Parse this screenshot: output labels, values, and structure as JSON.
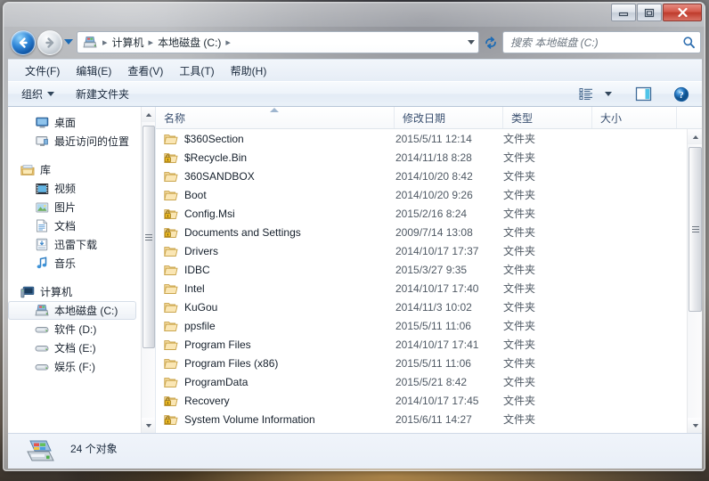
{
  "window": {
    "minimize_label": "最小化",
    "maximize_label": "最大化",
    "close_label": "关闭"
  },
  "nav": {
    "back_label": "后退",
    "forward_label": "前进",
    "history_label": "历史记录",
    "refresh_label": "刷新",
    "breadcrumbs": [
      "计算机",
      "本地磁盘 (C:)"
    ],
    "separator": "▸"
  },
  "search": {
    "placeholder": "搜索 本地磁盘 (C:)",
    "value": ""
  },
  "menubar": {
    "items": [
      {
        "label": "文件(F)"
      },
      {
        "label": "编辑(E)"
      },
      {
        "label": "查看(V)"
      },
      {
        "label": "工具(T)"
      },
      {
        "label": "帮助(H)"
      }
    ]
  },
  "toolbar": {
    "organize_label": "组织",
    "new_folder_label": "新建文件夹",
    "view_label": "更改视图",
    "preview_label": "显示预览窗格",
    "help_label": "帮助"
  },
  "sidebar": {
    "items": [
      {
        "label": "桌面",
        "icon": "desktop-icon",
        "level": "child"
      },
      {
        "label": "最近访问的位置",
        "icon": "recent-icon",
        "level": "child"
      },
      {
        "label": "库",
        "icon": "library-icon",
        "level": "group"
      },
      {
        "label": "视频",
        "icon": "video-icon",
        "level": "child"
      },
      {
        "label": "图片",
        "icon": "picture-icon",
        "level": "child"
      },
      {
        "label": "文档",
        "icon": "document-icon",
        "level": "child"
      },
      {
        "label": "迅雷下载",
        "icon": "download-icon",
        "level": "child"
      },
      {
        "label": "音乐",
        "icon": "music-icon",
        "level": "child"
      },
      {
        "label": "计算机",
        "icon": "computer-icon",
        "level": "group"
      },
      {
        "label": "本地磁盘 (C:)",
        "icon": "harddisk-icon",
        "level": "child",
        "selected": true
      },
      {
        "label": "软件 (D:)",
        "icon": "drive-icon",
        "level": "child"
      },
      {
        "label": "文档 (E:)",
        "icon": "drive-icon",
        "level": "child"
      },
      {
        "label": "娱乐 (F:)",
        "icon": "drive-icon",
        "level": "child"
      }
    ]
  },
  "filelist": {
    "columns": [
      {
        "label": "名称",
        "key": "name",
        "sorted": "asc"
      },
      {
        "label": "修改日期",
        "key": "date"
      },
      {
        "label": "类型",
        "key": "type"
      },
      {
        "label": "大小",
        "key": "size"
      }
    ],
    "rows": [
      {
        "name": "$360Section",
        "date": "2015/5/11 12:14",
        "type": "文件夹",
        "size": "",
        "icon": "folder-icon"
      },
      {
        "name": "$Recycle.Bin",
        "date": "2014/11/18 8:28",
        "type": "文件夹",
        "size": "",
        "icon": "folder-locked-icon"
      },
      {
        "name": "360SANDBOX",
        "date": "2014/10/20 8:42",
        "type": "文件夹",
        "size": "",
        "icon": "folder-icon"
      },
      {
        "name": "Boot",
        "date": "2014/10/20 9:26",
        "type": "文件夹",
        "size": "",
        "icon": "folder-icon"
      },
      {
        "name": "Config.Msi",
        "date": "2015/2/16 8:24",
        "type": "文件夹",
        "size": "",
        "icon": "folder-locked-icon"
      },
      {
        "name": "Documents and Settings",
        "date": "2009/7/14 13:08",
        "type": "文件夹",
        "size": "",
        "icon": "folder-locked-icon"
      },
      {
        "name": "Drivers",
        "date": "2014/10/17 17:37",
        "type": "文件夹",
        "size": "",
        "icon": "folder-icon"
      },
      {
        "name": "IDBC",
        "date": "2015/3/27 9:35",
        "type": "文件夹",
        "size": "",
        "icon": "folder-icon"
      },
      {
        "name": "Intel",
        "date": "2014/10/17 17:40",
        "type": "文件夹",
        "size": "",
        "icon": "folder-icon"
      },
      {
        "name": "KuGou",
        "date": "2014/11/3 10:02",
        "type": "文件夹",
        "size": "",
        "icon": "folder-icon"
      },
      {
        "name": "ppsfile",
        "date": "2015/5/11 11:06",
        "type": "文件夹",
        "size": "",
        "icon": "folder-icon"
      },
      {
        "name": "Program Files",
        "date": "2014/10/17 17:41",
        "type": "文件夹",
        "size": "",
        "icon": "folder-icon"
      },
      {
        "name": "Program Files (x86)",
        "date": "2015/5/11 11:06",
        "type": "文件夹",
        "size": "",
        "icon": "folder-icon"
      },
      {
        "name": "ProgramData",
        "date": "2015/5/21 8:42",
        "type": "文件夹",
        "size": "",
        "icon": "folder-icon"
      },
      {
        "name": "Recovery",
        "date": "2014/10/17 17:45",
        "type": "文件夹",
        "size": "",
        "icon": "folder-locked-icon"
      },
      {
        "name": "System Volume Information",
        "date": "2015/6/11 14:27",
        "type": "文件夹",
        "size": "",
        "icon": "folder-locked-icon"
      }
    ]
  },
  "status": {
    "item_count_text": "24 个对象",
    "drive_icon": "harddisk-icon"
  },
  "colors": {
    "accent_blue": "#1c6bb5",
    "folder_yellow": "#f5c96a",
    "close_red": "#bf3b2c",
    "header_text": "#3a5070"
  }
}
